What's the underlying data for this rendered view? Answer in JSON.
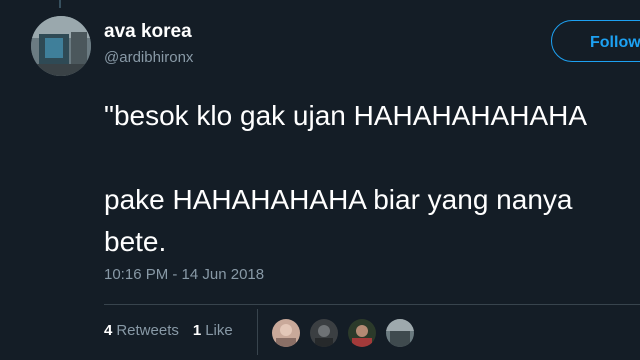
{
  "author": {
    "display_name": "ava korea",
    "handle": "@ardibhironx"
  },
  "follow_label": "Follow",
  "tweet": {
    "text": "\"besok klo gak ujan HAHAHAHAHAHA\n\npake HAHAHAHAHA biar yang nanya\nbete.",
    "timestamp": "10:16 PM - 14 Jun 2018"
  },
  "stats": {
    "retweets_count": "4",
    "retweets_label": "Retweets",
    "likes_count": "1",
    "likes_label": "Like"
  },
  "colors": {
    "background": "#141d26",
    "accent": "#1da1f2",
    "muted_text": "#8899a6",
    "divider": "#38444d"
  }
}
